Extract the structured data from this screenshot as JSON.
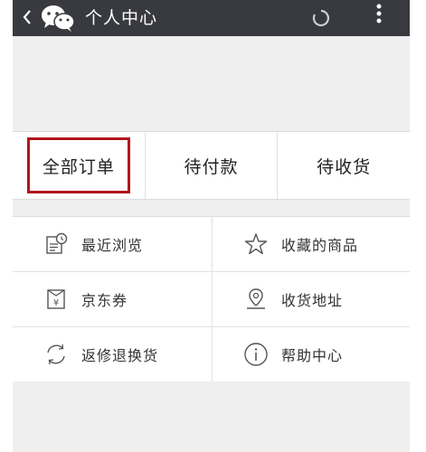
{
  "header": {
    "title": "个人中心",
    "bg_color": "#393a3f",
    "icons": [
      "back-arrow-icon",
      "wechat-logo-icon",
      "loading-spinner-icon",
      "more-menu-icon"
    ]
  },
  "orders": {
    "tabs": [
      {
        "label": "全部订单",
        "highlighted": true
      },
      {
        "label": "待付款",
        "highlighted": false
      },
      {
        "label": "待收货",
        "highlighted": false
      }
    ],
    "highlight_color": "#b0161c"
  },
  "menu": {
    "items": [
      {
        "label": "最近浏览",
        "icon": "recent-history-icon"
      },
      {
        "label": "收藏的商品",
        "icon": "star-icon"
      },
      {
        "label": "京东券",
        "icon": "coupon-icon"
      },
      {
        "label": "收货地址",
        "icon": "location-pin-icon"
      },
      {
        "label": "返修退换货",
        "icon": "refresh-return-icon"
      },
      {
        "label": "帮助中心",
        "icon": "info-icon"
      }
    ]
  }
}
